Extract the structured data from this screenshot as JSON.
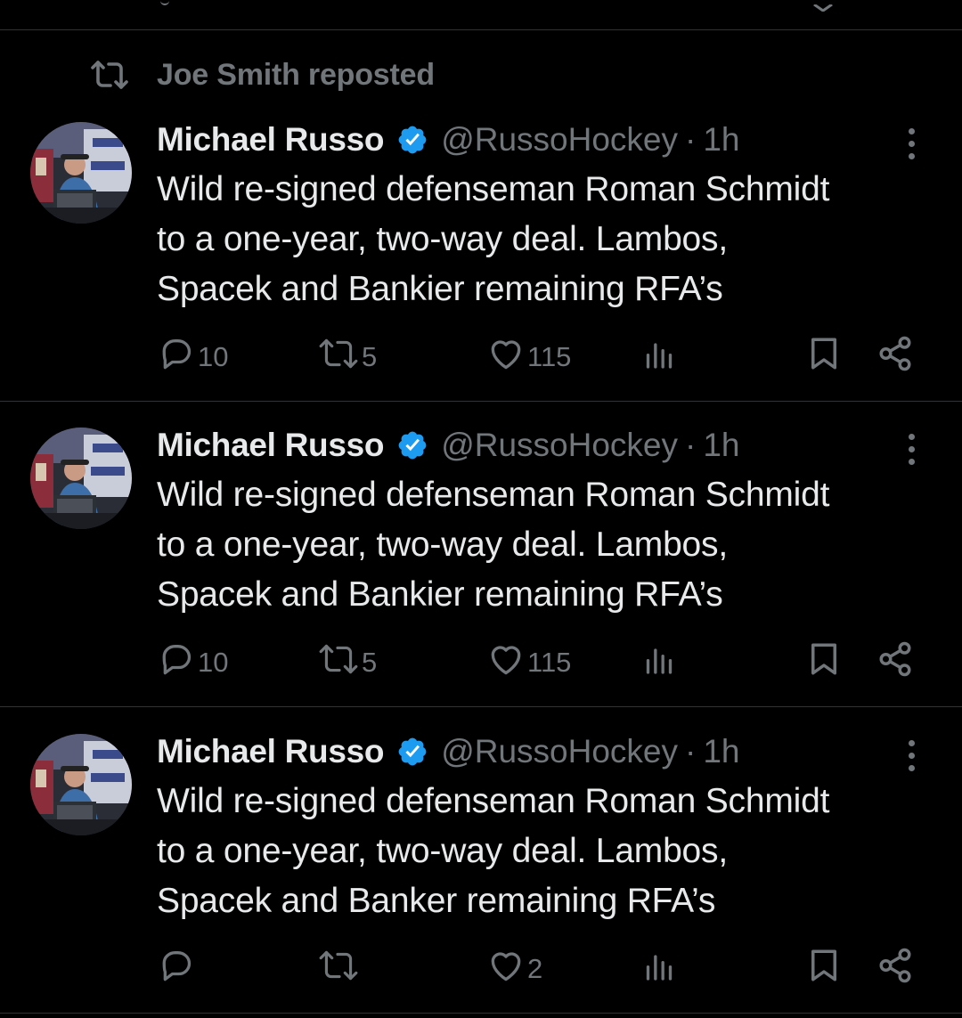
{
  "repost_header": {
    "label": "Joe Smith reposted"
  },
  "tweets": [
    {
      "author": {
        "name": "Michael Russo",
        "handle": "@RussoHockey",
        "time": "1h",
        "verified": true
      },
      "text": [
        "Wild re-signed defenseman Roman Schmidt",
        "to a one-year, two-way deal. Lambos,",
        "Spacek and Bankier remaining RFA’s"
      ],
      "stats": {
        "replies": "10",
        "reposts": "5",
        "likes": "115"
      }
    },
    {
      "author": {
        "name": "Michael Russo",
        "handle": "@RussoHockey",
        "time": "1h",
        "verified": true
      },
      "text": [
        "Wild re-signed defenseman Roman Schmidt",
        "to a one-year, two-way deal. Lambos,",
        "Spacek and Bankier remaining RFA’s"
      ],
      "stats": {
        "replies": "10",
        "reposts": "5",
        "likes": "115"
      }
    },
    {
      "author": {
        "name": "Michael Russo",
        "handle": "@RussoHockey",
        "time": "1h",
        "verified": true
      },
      "text": [
        "Wild re-signed defenseman Roman Schmidt",
        "to a one-year, two-way deal. Lambos,",
        "Spacek and Banker remaining RFA’s"
      ],
      "stats": {
        "replies": "",
        "reposts": "",
        "likes": "2"
      }
    }
  ],
  "separator": "·",
  "icons": {
    "repost_header": "repost-icon",
    "verified": "verified-badge-icon",
    "more": "more-options-icon",
    "reply": "reply-icon",
    "repost": "repost-icon",
    "like": "heart-icon",
    "views": "views-icon",
    "bookmark": "bookmark-icon",
    "share": "share-icon"
  },
  "colors": {
    "background": "#000000",
    "text": "#e7e9ea",
    "muted": "#71767b",
    "divider": "#2f3336",
    "verified": "#1d9bf0"
  }
}
